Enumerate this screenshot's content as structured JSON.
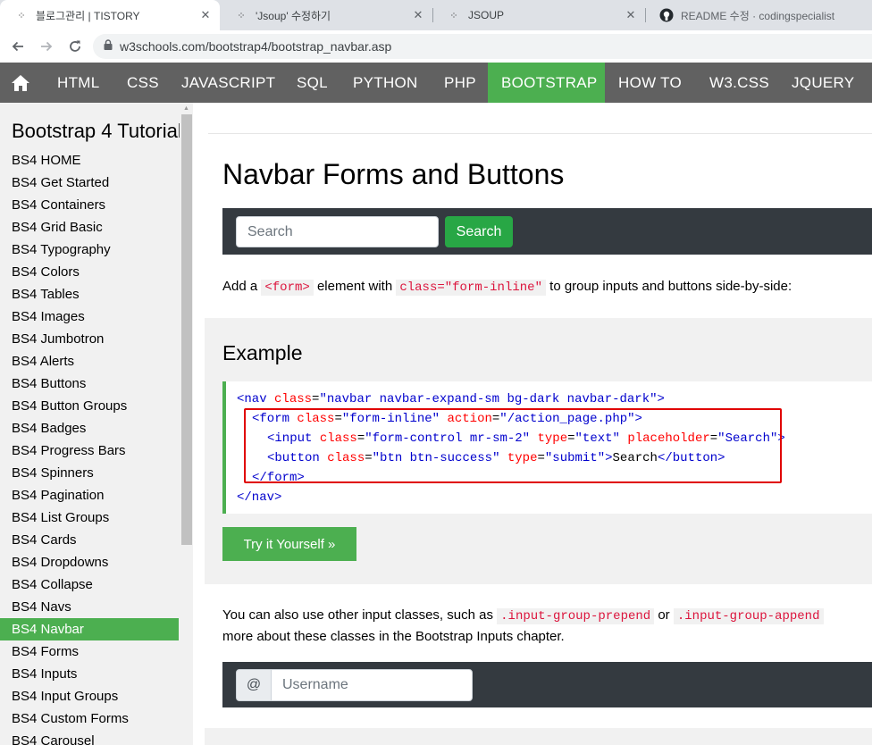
{
  "browser": {
    "tabs": [
      {
        "title": "블로그관리 | TISTORY",
        "favicon": "tistory-icon"
      },
      {
        "title": "'Jsoup' 수정하기",
        "favicon": "tistory-icon"
      },
      {
        "title": "JSOUP",
        "favicon": "tistory-icon"
      },
      {
        "title": "README 수정 · codingspecialist",
        "favicon": "github-icon"
      }
    ],
    "close_glyph": "✕",
    "url": "w3schools.com/bootstrap4/bootstrap_navbar.asp"
  },
  "topnav": {
    "items": [
      "HTML",
      "CSS",
      "JAVASCRIPT",
      "SQL",
      "PYTHON",
      "PHP",
      "BOOTSTRAP",
      "HOW TO",
      "W3.CSS",
      "JQUERY"
    ],
    "active": "BOOTSTRAP"
  },
  "sidebar": {
    "heading": "Bootstrap 4 Tutorial",
    "items": [
      "BS4 HOME",
      "BS4 Get Started",
      "BS4 Containers",
      "BS4 Grid Basic",
      "BS4 Typography",
      "BS4 Colors",
      "BS4 Tables",
      "BS4 Images",
      "BS4 Jumbotron",
      "BS4 Alerts",
      "BS4 Buttons",
      "BS4 Button Groups",
      "BS4 Badges",
      "BS4 Progress Bars",
      "BS4 Spinners",
      "BS4 Pagination",
      "BS4 List Groups",
      "BS4 Cards",
      "BS4 Dropdowns",
      "BS4 Collapse",
      "BS4 Navs",
      "BS4 Navbar",
      "BS4 Forms",
      "BS4 Inputs",
      "BS4 Input Groups",
      "BS4 Custom Forms",
      "BS4 Carousel"
    ],
    "active": "BS4 Navbar"
  },
  "main": {
    "title": "Navbar Forms and Buttons",
    "demo": {
      "search_placeholder": "Search",
      "search_button": "Search"
    },
    "intro": {
      "before": "Add a ",
      "code1": "<form>",
      "middle": " element with ",
      "code2": "class=\"form-inline\"",
      "after": " to group inputs and buttons side-by-side:"
    },
    "example": {
      "heading": "Example",
      "code": {
        "l1_tag": "<nav",
        "l1_attr": "class",
        "l1_val": "\"navbar navbar-expand-sm bg-dark navbar-dark\"",
        "l1_end": ">",
        "l2_tag": "<form",
        "l2_attr1": "class",
        "l2_val1": "\"form-inline\"",
        "l2_attr2": "action",
        "l2_val2": "\"/action_page.php\"",
        "l2_end": ">",
        "l3_tag": "<input",
        "l3_attr1": "class",
        "l3_val1": "\"form-control mr-sm-2\"",
        "l3_attr2": "type",
        "l3_val2": "\"text\"",
        "l3_attr3": "placeholder",
        "l3_val3": "\"Search\"",
        "l3_end": ">",
        "l4_tag": "<button",
        "l4_attr1": "class",
        "l4_val1": "\"btn btn-success\"",
        "l4_attr2": "type",
        "l4_val2": "\"submit\"",
        "l4_gt": ">",
        "l4_text": "Search",
        "l4_close": "</button>",
        "l5": "</form>",
        "l6": "</nav>"
      },
      "try_button": "Try it Yourself »"
    },
    "para2": {
      "before": "You can also use other input classes, such as ",
      "code1": ".input-group-prepend",
      "middle": " or ",
      "code2": ".input-group-append",
      "line2": "more about these classes in the Bootstrap Inputs chapter."
    },
    "demo2": {
      "prepend": "@",
      "username_placeholder": "Username"
    }
  }
}
